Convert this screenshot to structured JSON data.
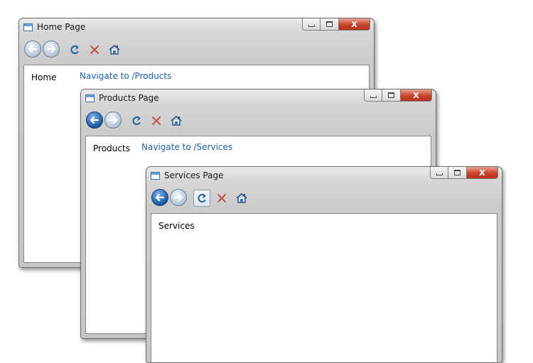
{
  "windows": [
    {
      "title": "Home Page",
      "page_label": "Home",
      "link_text": "Navigate to /Products"
    },
    {
      "title": "Products Page",
      "page_label": "Products",
      "link_text": "Navigate to /Services"
    },
    {
      "title": "Services Page",
      "page_label": "Services",
      "link_text": ""
    }
  ],
  "caption": {
    "close_label": "X"
  },
  "icons": {
    "back": "back-arrow-icon",
    "forward": "forward-arrow-icon",
    "refresh": "refresh-icon",
    "stop": "stop-icon",
    "home": "home-icon"
  },
  "colors": {
    "link": "#1d61a8",
    "stop": "#c0504d",
    "refresh": "#1d61a8",
    "close_button": "#c8442b"
  }
}
